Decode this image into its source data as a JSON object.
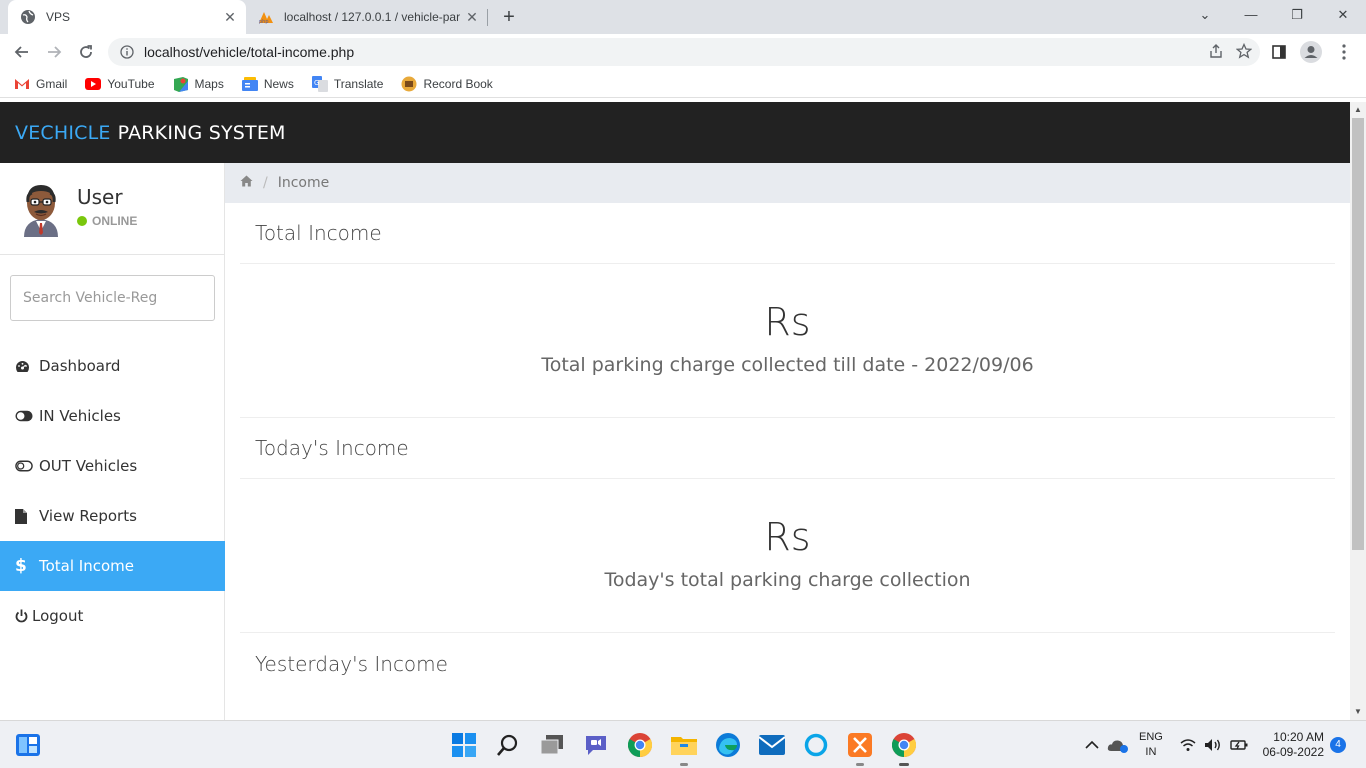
{
  "browser": {
    "tabs": [
      {
        "title": "VPS",
        "active": true
      },
      {
        "title": "localhost / 127.0.0.1 / vehicle-par",
        "active": false
      }
    ],
    "url": "localhost/vehicle/total-income.php",
    "bookmarks": [
      "Gmail",
      "YouTube",
      "Maps",
      "News",
      "Translate",
      "Record Book"
    ]
  },
  "app": {
    "brand_part1": "VECHICLE",
    "brand_part2": "PARKING SYSTEM"
  },
  "sidebar": {
    "user_name": "User",
    "user_status": "ONLINE",
    "search_placeholder": "Search Vehicle-Reg",
    "items": [
      {
        "label": "Dashboard",
        "icon": "dashboard-icon"
      },
      {
        "label": "IN Vehicles",
        "icon": "toggle-on-icon"
      },
      {
        "label": "OUT Vehicles",
        "icon": "toggle-off-icon"
      },
      {
        "label": "View Reports",
        "icon": "file-icon"
      },
      {
        "label": "Total Income",
        "icon": "dollar-icon",
        "active": true
      },
      {
        "label": "Logout",
        "icon": "power-icon"
      }
    ]
  },
  "breadcrumb": {
    "current": "Income"
  },
  "panels": [
    {
      "title": "Total Income",
      "amount": "Rs",
      "description": "Total parking charge collected till date - 2022/09/06"
    },
    {
      "title": "Today's Income",
      "amount": "Rs",
      "description": "Today's total parking charge collection"
    },
    {
      "title": "Yesterday's Income"
    }
  ],
  "taskbar": {
    "language": "ENG",
    "region": "IN",
    "time": "10:20 AM",
    "date": "06-09-2022",
    "notification_count": "4"
  },
  "colors": {
    "accent": "#3ba9f5",
    "header_bg": "#222222",
    "online": "#7ac70c"
  }
}
